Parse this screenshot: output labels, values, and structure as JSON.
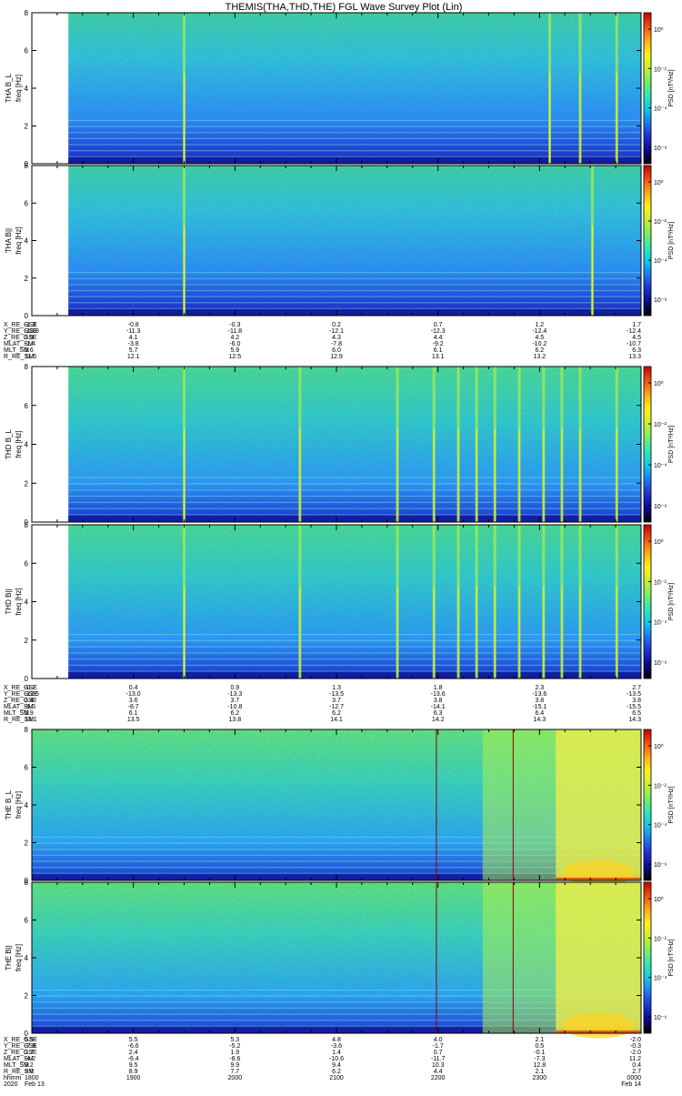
{
  "title": "THEMIS(THA,THD,THE) FGL Wave Survey Plot (Lin)",
  "colors": {
    "colorbar": [
      "#000000",
      "#0a0a8c",
      "#1e32d2",
      "#1e78f0",
      "#14c8e6",
      "#32e6b4",
      "#78f064",
      "#c8f032",
      "#fff01e",
      "#ffaa14",
      "#f05014",
      "#c80000"
    ],
    "event_line": "#8b0000"
  },
  "chart_data": {
    "type": "heatmap",
    "freq_axis": {
      "label": "freq [Hz]",
      "ylim": [
        0,
        8
      ],
      "ticks": [
        "0",
        "2",
        "4",
        "6",
        "8"
      ]
    },
    "colorbar": {
      "label": "PSD [nT²/Hz]",
      "scale": "log",
      "ticks": [
        "10⁰",
        "10⁻²",
        "10⁻⁴",
        "10⁻⁶"
      ]
    },
    "time_axis": {
      "start": "1800",
      "end": "0000",
      "unit": "hhmm"
    },
    "panels": [
      {
        "name": "THA B_L",
        "probe": "THA",
        "component": "B_L",
        "ylabel": "THA B_L",
        "data_start_frac": 0.06,
        "intensity": {
          "base": "cyan-blue",
          "low_freq_band": "dark blue"
        },
        "bursts": [
          0.25,
          0.85,
          0.9,
          0.96
        ]
      },
      {
        "name": "THA B||",
        "probe": "THA",
        "component": "B||",
        "ylabel": "THA B||",
        "data_start_frac": 0.06,
        "intensity": {
          "base": "cyan-blue",
          "low_freq_band": "dark blue"
        },
        "bursts": [
          0.25,
          0.92
        ]
      },
      {
        "name": "THD B_L",
        "probe": "THD",
        "component": "B_L",
        "ylabel": "THD B_L",
        "data_start_frac": 0.06,
        "intensity": {
          "base": "cyan",
          "low_freq_band": "blue"
        },
        "bursts": [
          0.25,
          0.44,
          0.6,
          0.66,
          0.7,
          0.73,
          0.76,
          0.8,
          0.84,
          0.87,
          0.9,
          0.96
        ]
      },
      {
        "name": "THD B||",
        "probe": "THD",
        "component": "B||",
        "ylabel": "THD B||",
        "data_start_frac": 0.06,
        "intensity": {
          "base": "cyan",
          "low_freq_band": "blue"
        },
        "bursts": [
          0.25,
          0.44,
          0.6,
          0.66,
          0.7,
          0.73,
          0.76,
          0.8,
          0.84,
          0.87,
          0.9,
          0.96
        ]
      },
      {
        "name": "THE B_L",
        "probe": "THE",
        "component": "B_L",
        "ylabel": "THE B_L",
        "data_start_frac": 0.0,
        "intensity": {
          "base": "cyan",
          "enhanced_after": 0.74,
          "strong_after": 0.86
        },
        "event_lines": [
          0.664,
          0.79
        ]
      },
      {
        "name": "THE B||",
        "probe": "THE",
        "component": "B||",
        "ylabel": "THE B||",
        "data_start_frac": 0.0,
        "intensity": {
          "base": "cyan",
          "enhanced_after": 0.74,
          "strong_after": 0.86
        },
        "event_lines": [
          0.664,
          0.79
        ]
      }
    ],
    "ephemeris": [
      {
        "rows": [
          {
            "label": "X_RE_GSE",
            "values": [
              "-1.3",
              "-0.8",
              "-0.3",
              "0.2",
              "0.7",
              "1.2",
              "1.7"
            ]
          },
          {
            "label": "Y_RE_GSE",
            "values": [
              "-10.8",
              "-11.3",
              "-11.8",
              "-12.1",
              "-12.3",
              "-12.4",
              "-12.4"
            ]
          },
          {
            "label": "Z_RE_GSE",
            "values": [
              "3.9",
              "4.1",
              "4.2",
              "4.3",
              "4.4",
              "4.5",
              "4.5"
            ]
          },
          {
            "label": "MLAT_SM",
            "values": [
              "-1.4",
              "-3.8",
              "-6.0",
              "-7.8",
              "-9.2",
              "-10.2",
              "-10.7"
            ]
          },
          {
            "label": "MLT_SM",
            "values": [
              "5.6",
              "5.7",
              "5.9",
              "6.0",
              "6.1",
              "6.2",
              "6.3"
            ]
          },
          {
            "label": "R_RE_SM",
            "values": [
              "11.5",
              "12.1",
              "12.5",
              "12.9",
              "13.1",
              "13.2",
              "13.3"
            ]
          }
        ]
      },
      {
        "rows": [
          {
            "label": "X_RE_GSE",
            "values": [
              "-0.1",
              "0.4",
              "0.9",
              "1.3",
              "1.8",
              "2.3",
              "2.7"
            ]
          },
          {
            "label": "Y_RE_GSE",
            "values": [
              "-12.6",
              "-13.0",
              "-13.3",
              "-13.5",
              "-13.6",
              "-13.6",
              "-13.5"
            ]
          },
          {
            "label": "Z_RE_GSE",
            "values": [
              "3.4",
              "3.6",
              "3.7",
              "3.7",
              "3.8",
              "3.8",
              "3.8"
            ]
          },
          {
            "label": "MLAT_SM",
            "values": [
              "-6.3",
              "-8.7",
              "-10.8",
              "-12.7",
              "-14.1",
              "-15.1",
              "-15.5"
            ]
          },
          {
            "label": "MLT_SM",
            "values": [
              "5.9",
              "6.1",
              "6.2",
              "6.2",
              "6.3",
              "6.4",
              "6.5"
            ]
          },
          {
            "label": "R_RE_SM",
            "values": [
              "13.1",
              "13.5",
              "13.8",
              "14.1",
              "14.2",
              "14.3",
              "14.3"
            ]
          }
        ]
      },
      {
        "rows": [
          {
            "label": "X_RE_GSE",
            "values": [
              "5.5",
              "5.5",
              "5.3",
              "4.8",
              "4.0",
              "2.1",
              "-2.0"
            ]
          },
          {
            "label": "Y_RE_GSE",
            "values": [
              "-7.8",
              "-6.6",
              "-5.2",
              "-3.6",
              "-1.7",
              "0.5",
              "-0.3"
            ]
          },
          {
            "label": "Z_RE_GSE",
            "values": [
              "2.7",
              "2.4",
              "1.9",
              "1.4",
              "0.7",
              "-0.1",
              "-2.0"
            ]
          },
          {
            "label": "MLAT_SM",
            "values": [
              "-4.2",
              "-6.4",
              "-8.6",
              "-10.6",
              "-11.7",
              "-7.3",
              "11.2"
            ]
          },
          {
            "label": "MLT_SM",
            "values": [
              "9.2",
              "9.5",
              "9.9",
              "9.4",
              "10.3",
              "12.8",
              "0.4"
            ]
          },
          {
            "label": "R_RE_SM",
            "values": [
              "9.9",
              "8.9",
              "7.7",
              "6.2",
              "4.4",
              "2.1",
              "2.7"
            ]
          },
          {
            "label": "hhmm",
            "values": [
              "1800",
              "1900",
              "2000",
              "2100",
              "2200",
              "2300",
              "0000"
            ]
          },
          {
            "label": "2020",
            "values": [
              "Feb 13",
              "",
              "",
              "",
              "",
              "",
              "Feb 14"
            ]
          }
        ]
      }
    ]
  }
}
